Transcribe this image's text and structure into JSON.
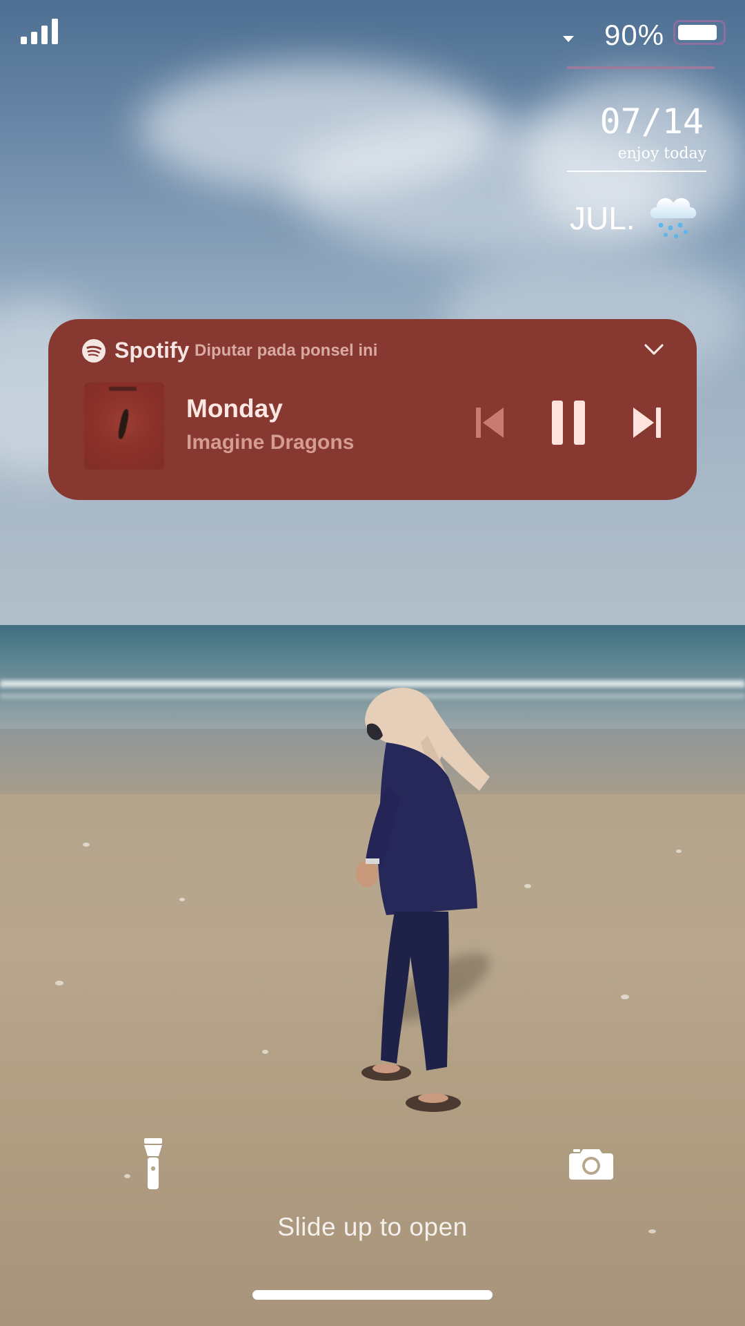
{
  "status_bar": {
    "battery_percent_text": "90%",
    "battery_level": 0.9,
    "signal_bars": 4,
    "signal_icon": "cellular-signal-icon",
    "wifi_icon": "wifi-icon",
    "accent_line_color": "#9c7a9c"
  },
  "date_widget": {
    "date": "07/14",
    "tagline": "enjoy today",
    "month": "JUL.",
    "weather_icon": "rain-cloud-icon"
  },
  "media_player": {
    "app_name": "Spotify",
    "app_icon": "spotify-icon",
    "status": "Diputar pada ponsel ini",
    "track_title": "Monday",
    "artist": "Imagine Dragons",
    "album_art": "album-art",
    "collapse_icon": "chevron-down-icon",
    "controls": {
      "previous_icon": "skip-previous-icon",
      "pause_icon": "pause-icon",
      "next_icon": "skip-next-icon"
    },
    "background_color": "#873830"
  },
  "lockscreen": {
    "flashlight_icon": "flashlight-icon",
    "camera_icon": "camera-icon",
    "unlock_hint": "Slide up to open"
  }
}
